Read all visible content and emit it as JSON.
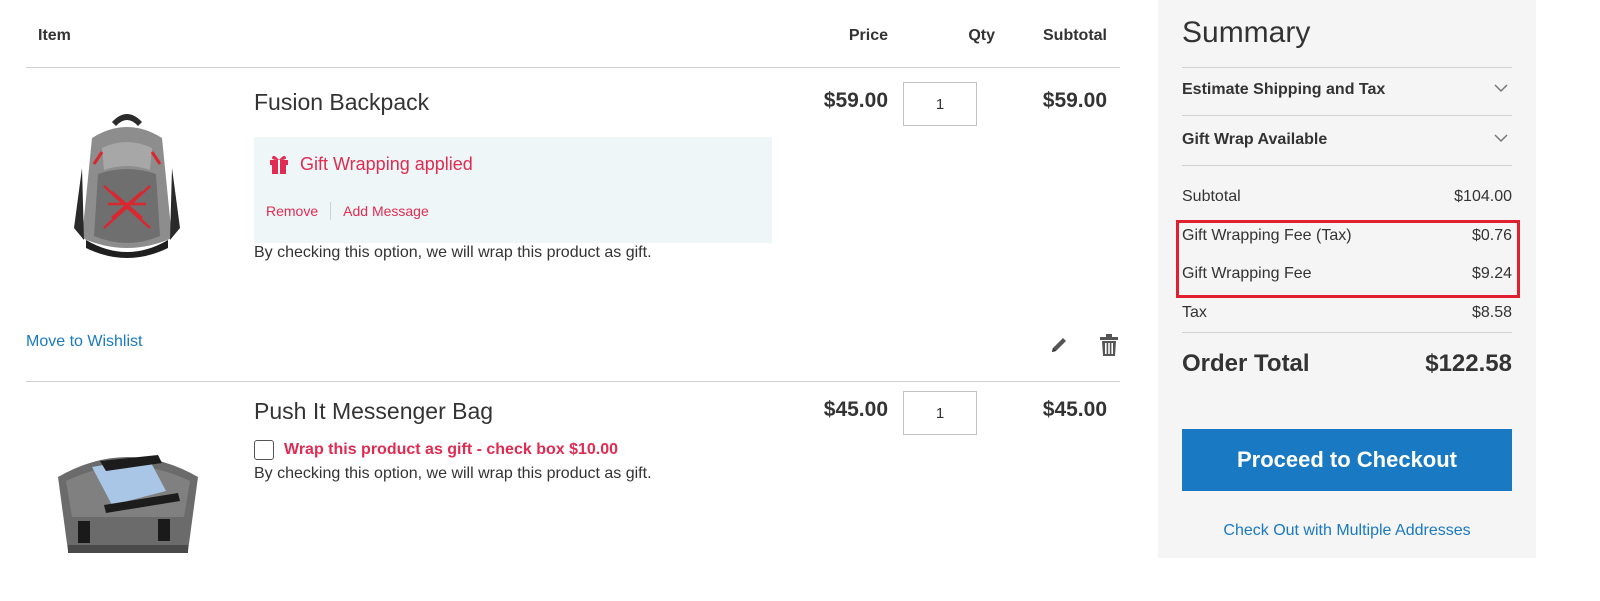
{
  "cart": {
    "headers": {
      "item": "Item",
      "price": "Price",
      "qty": "Qty",
      "subtotal": "Subtotal"
    },
    "items": [
      {
        "name": "Fusion Backpack",
        "price": "$59.00",
        "qty": "1",
        "subtotal": "$59.00",
        "gift_applied": "Gift Wrapping applied",
        "remove_label": "Remove",
        "add_message_label": "Add Message",
        "note": "By checking this option, we will wrap this product as gift.",
        "wishlist_label": "Move to Wishlist",
        "image_icon": "backpack-image"
      },
      {
        "name": "Push It Messenger Bag",
        "price": "$45.00",
        "qty": "1",
        "subtotal": "$45.00",
        "wrap_option": "Wrap this product as gift - check box $10.00",
        "wrap_checked": false,
        "note": "By checking this option, we will wrap this product as gift.",
        "image_icon": "messenger-bag-image"
      }
    ]
  },
  "summary": {
    "title": "Summary",
    "estimate_label": "Estimate Shipping and Tax",
    "giftwrap_label": "Gift Wrap Available",
    "totals": [
      {
        "label": "Subtotal",
        "value": "$104.00"
      },
      {
        "label": "Gift Wrapping Fee (Tax)",
        "value": "$0.76"
      },
      {
        "label": "Gift Wrapping Fee",
        "value": "$9.24"
      },
      {
        "label": "Tax",
        "value": "$8.58"
      }
    ],
    "order_total_label": "Order Total",
    "order_total_value": "$122.58",
    "checkout_label": "Proceed to Checkout",
    "multi_label": "Check Out with Multiple Addresses"
  },
  "colors": {
    "accent_blue": "#1979c3",
    "gift_red": "#e02b52",
    "highlight_red": "#e0202f",
    "gift_box_bg": "#eef6f7",
    "summary_bg": "#f5f5f5"
  }
}
